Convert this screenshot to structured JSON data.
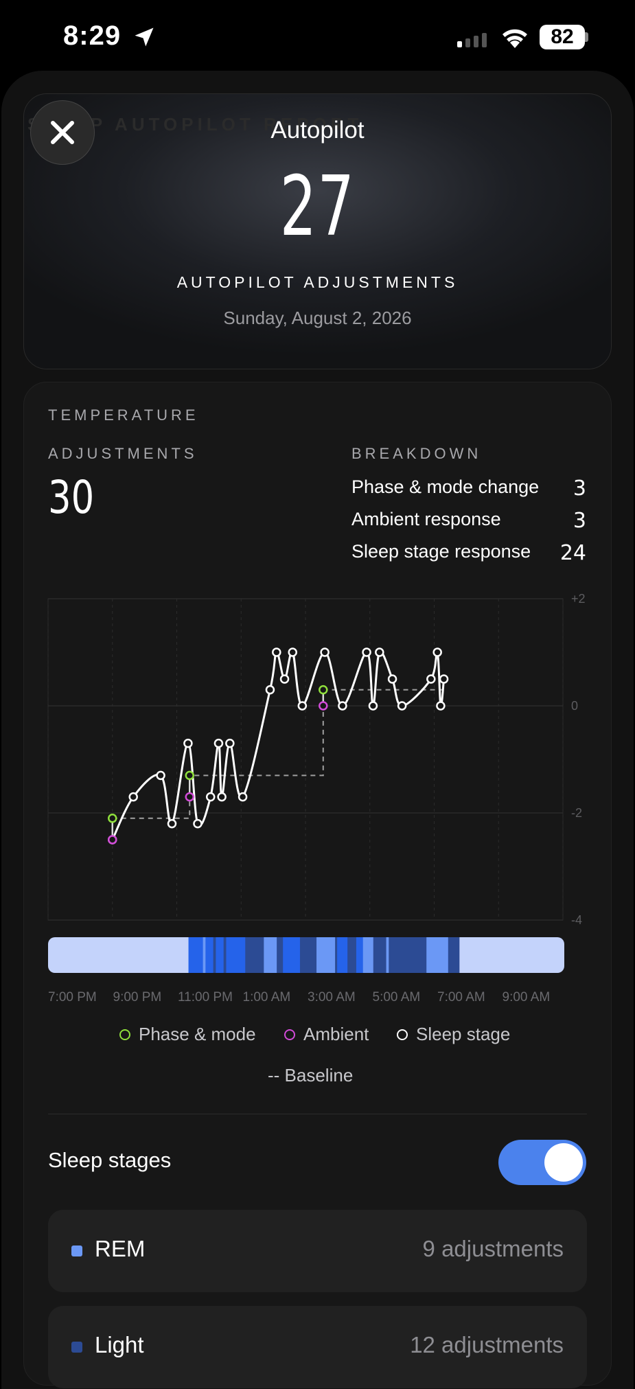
{
  "status_bar": {
    "time": "8:29",
    "battery": "82"
  },
  "header": {
    "title": "Autopilot",
    "ghost_label": "SLEEP AUTOPILOT REPORT"
  },
  "hero": {
    "count": "27",
    "label": "AUTOPILOT ADJUSTMENTS",
    "date": "Sunday, August 2, 2026"
  },
  "temperature": {
    "section_label": "TEMPERATURE",
    "adjustments_label": "ADJUSTMENTS",
    "adjustments_value": "30",
    "breakdown_label": "BREAKDOWN",
    "breakdown": [
      {
        "label": "Phase & mode change",
        "value": "3"
      },
      {
        "label": "Ambient response",
        "value": "3"
      },
      {
        "label": "Sleep stage response",
        "value": "24"
      }
    ]
  },
  "chart_data": {
    "type": "line",
    "y_ticks": [
      "+2",
      "0",
      "-2",
      "-4"
    ],
    "ylim": [
      -4,
      2
    ],
    "x_ticks": [
      "7:00 PM",
      "9:00 PM",
      "11:00 PM",
      "1:00 AM",
      "3:00 AM",
      "5:00 AM",
      "7:00 AM",
      "9:00 AM"
    ],
    "legend": [
      {
        "name": "Phase & mode",
        "color": "#8fe03c"
      },
      {
        "name": "Ambient",
        "color": "#d24bd8"
      },
      {
        "name": "Sleep stage",
        "color": "#ffffff"
      }
    ],
    "baseline_label": "-- Baseline",
    "series": [
      {
        "name": "Sleep stage",
        "points": [
          [
            2.0,
            -2.5
          ],
          [
            2.65,
            -1.7
          ],
          [
            3.5,
            -1.3
          ],
          [
            3.85,
            -2.2
          ],
          [
            4.35,
            -0.7
          ],
          [
            4.65,
            -2.2
          ],
          [
            5.05,
            -1.7
          ],
          [
            5.3,
            -0.7
          ],
          [
            5.4,
            -1.7
          ],
          [
            5.65,
            -0.7
          ],
          [
            6.05,
            -1.7
          ],
          [
            6.9,
            0.3
          ],
          [
            7.1,
            1.0
          ],
          [
            7.35,
            0.5
          ],
          [
            7.6,
            1.0
          ],
          [
            7.9,
            0.0
          ],
          [
            8.6,
            1.0
          ],
          [
            9.15,
            0.0
          ],
          [
            9.9,
            1.0
          ],
          [
            10.1,
            0.0
          ],
          [
            10.3,
            1.0
          ],
          [
            10.7,
            0.5
          ],
          [
            11.0,
            0.0
          ],
          [
            11.9,
            0.5
          ],
          [
            12.1,
            1.0
          ],
          [
            12.2,
            0.0
          ],
          [
            12.3,
            0.5
          ]
        ]
      },
      {
        "name": "Phase & mode",
        "points": [
          [
            2.0,
            -2.1
          ],
          [
            4.4,
            -1.3
          ],
          [
            8.55,
            0.3
          ]
        ]
      },
      {
        "name": "Ambient",
        "points": [
          [
            2.0,
            -2.5
          ],
          [
            4.4,
            -1.7
          ],
          [
            8.55,
            0.0
          ]
        ]
      },
      {
        "name": "Baseline",
        "points": [
          [
            2.0,
            -2.1
          ],
          [
            4.4,
            -2.1
          ],
          [
            4.4,
            -1.3
          ],
          [
            8.55,
            -1.3
          ],
          [
            8.55,
            0.3
          ],
          [
            12.25,
            0.3
          ]
        ]
      }
    ],
    "hypnogram": {
      "stages": [
        "Awake",
        "REM",
        "Light",
        "Deep"
      ],
      "colors": {
        "Awake": "#c4d3fb",
        "REM": "#6b98f5",
        "Light": "#2563ea",
        "Deep": "#2c4b94"
      },
      "segments": [
        [
          "Awake",
          0.0,
          0.272
        ],
        [
          "Light",
          0.272,
          0.3
        ],
        [
          "REM",
          0.3,
          0.305
        ],
        [
          "Light",
          0.305,
          0.32
        ],
        [
          "Deep",
          0.32,
          0.325
        ],
        [
          "Light",
          0.325,
          0.34
        ],
        [
          "Deep",
          0.34,
          0.345
        ],
        [
          "Light",
          0.345,
          0.382
        ],
        [
          "Deep",
          0.382,
          0.418
        ],
        [
          "REM",
          0.418,
          0.443
        ],
        [
          "Deep",
          0.443,
          0.455
        ],
        [
          "Light",
          0.455,
          0.488
        ],
        [
          "Deep",
          0.488,
          0.52
        ],
        [
          "REM",
          0.52,
          0.556
        ],
        [
          "Deep",
          0.556,
          0.56
        ],
        [
          "Light",
          0.56,
          0.58
        ],
        [
          "Deep",
          0.58,
          0.597
        ],
        [
          "Light",
          0.597,
          0.61
        ],
        [
          "REM",
          0.61,
          0.63
        ],
        [
          "Deep",
          0.63,
          0.655
        ],
        [
          "REM",
          0.655,
          0.66
        ],
        [
          "Deep",
          0.66,
          0.733
        ],
        [
          "REM",
          0.733,
          0.775
        ],
        [
          "Deep",
          0.775,
          0.797
        ],
        [
          "Awake",
          0.797,
          1.0
        ]
      ]
    }
  },
  "sleep_stages": {
    "toggle_label": "Sleep stages",
    "toggle_on": true,
    "rows": [
      {
        "name": "REM",
        "count": "9 adjustments",
        "color": "#6b98f5"
      },
      {
        "name": "Light",
        "count": "12 adjustments",
        "color": "#2c4b94"
      }
    ]
  }
}
